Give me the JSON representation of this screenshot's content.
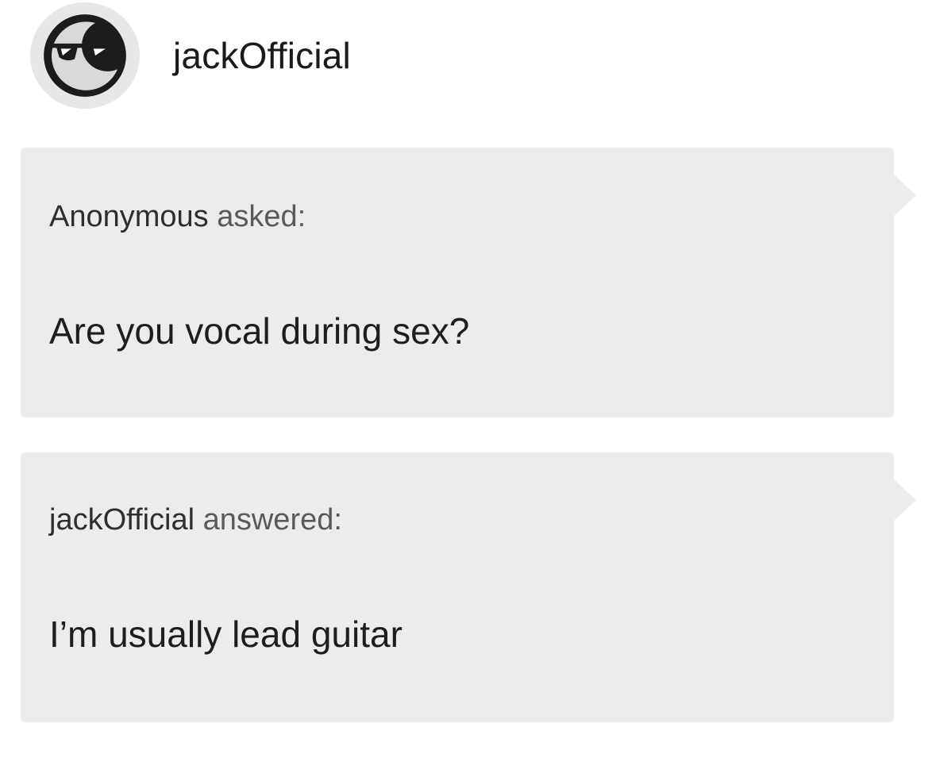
{
  "post": {
    "author": "jackOfficial",
    "avatar_icon": "sunglasses-face-icon"
  },
  "ask": {
    "asker": "Anonymous",
    "verb": "asked:",
    "question": "Are you vocal during sex?"
  },
  "answer": {
    "answerer": "jackOfficial",
    "verb": "answered:",
    "text": "I’m usually lead guitar"
  },
  "colors": {
    "page_background": "#ffffff",
    "bubble_background": "#ececec",
    "avatar_ring": "#e7e7e7",
    "avatar_fill": "#1c1c1c"
  }
}
